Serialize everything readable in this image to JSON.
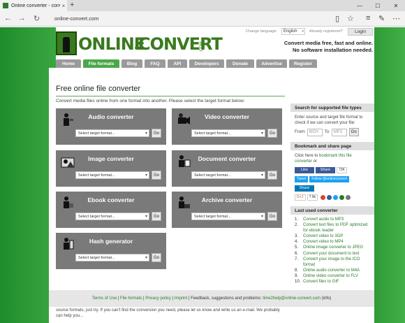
{
  "browser": {
    "tab_title": "Online converter - conv",
    "tab_close": "×",
    "new_tab": "+",
    "win_min": "—",
    "win_max": "☐",
    "win_close": "✕",
    "url": "online-convert.com",
    "icons": [
      "back-icon",
      "forward-icon",
      "refresh-icon",
      "reading-view-icon",
      "favorite-star-icon",
      "hub-icon",
      "notes-icon",
      "more-icon"
    ]
  },
  "header": {
    "logo_part1": "ONLINE",
    "logo_dash": "-",
    "logo_part2": "CONVERT",
    "logo_com": ".COM",
    "change_language_label": "Change language:",
    "language_value": "English",
    "already_registered": "Already registered?",
    "login_label": "Login",
    "slogan_line1": "Convert media free, fast and online.",
    "slogan_line2": "No software installation needed."
  },
  "menu": [
    {
      "label": "Home",
      "active": false
    },
    {
      "label": "File formats",
      "active": true
    },
    {
      "label": "Blog",
      "active": false
    },
    {
      "label": "FAQ",
      "active": false
    },
    {
      "label": "API",
      "active": false
    },
    {
      "label": "Developers",
      "active": false
    },
    {
      "label": "Donate",
      "active": false
    },
    {
      "label": "Advertise",
      "active": false
    },
    {
      "label": "Register",
      "active": false
    }
  ],
  "main": {
    "title": "Free online file converter",
    "intro": "Convert media files online from one format into another. Please select the target format below:",
    "select_placeholder": "Select target format...",
    "go_label": "Go",
    "converters": [
      {
        "title": "Audio converter"
      },
      {
        "title": "Video converter"
      },
      {
        "title": "Image converter"
      },
      {
        "title": "Document converter"
      },
      {
        "title": "Ebook converter"
      },
      {
        "title": "Archive converter"
      },
      {
        "title": "Hash generator"
      }
    ],
    "bottom_text": "This free online file converter lets you convert media easy and fast from one format to another. We support a lot of different source formats, just try. If you can't find the conversion you need, please let us know and write us an e-mail. We probably can help you..."
  },
  "sidebar": {
    "search_title": "Search for supported file types",
    "search_desc": "Enter source and target file format to check if we can convert your file:",
    "from_label": "From:",
    "from_placeholder": "MOV",
    "to_label": "To:",
    "to_placeholder": "MP3",
    "go_label": "Go",
    "bookmark_title": "Bookmark and share page",
    "bookmark_prefix": "Click here to ",
    "bookmark_link": "bookmark this file converter",
    "bookmark_suffix": " or",
    "fb_like": "Like",
    "fb_share": "Share",
    "fb_count": "73K",
    "tweet": "Tweet",
    "follow": "Follow @onlineconvert",
    "li_share": "Share",
    "gplus": "G+1",
    "gplus_count": "7.9k",
    "used_title": "Last used converter",
    "used": [
      "Convert audio to MP3",
      "Convert text files to PDF optimized for ebook reader",
      "Convert video to 3GP",
      "Convert video to MP4",
      "Online image converter to JPEG",
      "Convert your document to text",
      "Convert your image to the ICO format",
      "Online audio converter to M4A",
      "Online video converter to FLV",
      "Convert files to GIF"
    ]
  },
  "footer": {
    "terms": "Terms of Use",
    "formats": "File formats",
    "privacy": "Privacy policy",
    "imprint": "Imprint",
    "feedback": "Feedback, suggestions and problems:",
    "email": "time2help@online-convert.com",
    "info": "(info)",
    "sep": "|"
  }
}
